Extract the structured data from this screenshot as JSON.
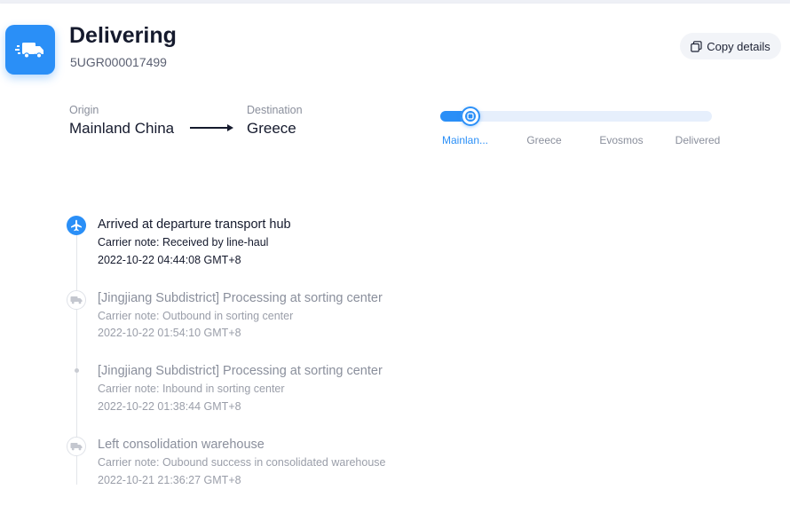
{
  "colors": {
    "accent": "#2a8ff7",
    "text_primary": "#151a2d",
    "text_muted": "#8a8f9c",
    "track": "#e6effc"
  },
  "header": {
    "status": "Delivering",
    "tracking_number": "5UGR000017499",
    "status_icon": "truck-icon",
    "copy_button": {
      "label": "Copy details",
      "icon": "copy-icon"
    }
  },
  "route": {
    "origin_label": "Origin",
    "origin_value": "Mainland China",
    "destination_label": "Destination",
    "destination_value": "Greece"
  },
  "progress": {
    "current_stage_index": 0,
    "fill_fraction": 0.11,
    "stages": [
      {
        "label": "Mainlan...",
        "active": true
      },
      {
        "label": "Greece",
        "active": false
      },
      {
        "label": "Evosmos",
        "active": false
      },
      {
        "label": "Delivered",
        "active": false
      }
    ]
  },
  "events": [
    {
      "title": "Arrived at departure transport hub",
      "note": "Carrier note: Received by line-haul",
      "time": "2022-10-22 04:44:08 GMT+8",
      "icon": "plane-icon",
      "state": "active"
    },
    {
      "title": "[Jingjiang Subdistrict] Processing at sorting center",
      "note": "Carrier note: Outbound in sorting center",
      "time": "2022-10-22 01:54:10 GMT+8",
      "icon": "truck-icon",
      "state": "past"
    },
    {
      "title": "[Jingjiang Subdistrict] Processing at sorting center",
      "note": "Carrier note: Inbound in sorting center",
      "time": "2022-10-22 01:38:44 GMT+8",
      "icon": "dot",
      "state": "past"
    },
    {
      "title": "Left consolidation warehouse",
      "note": "Carrier note: Oubound success in consolidated warehouse",
      "time": "2022-10-21 21:36:27 GMT+8",
      "icon": "truck-icon",
      "state": "past"
    }
  ]
}
